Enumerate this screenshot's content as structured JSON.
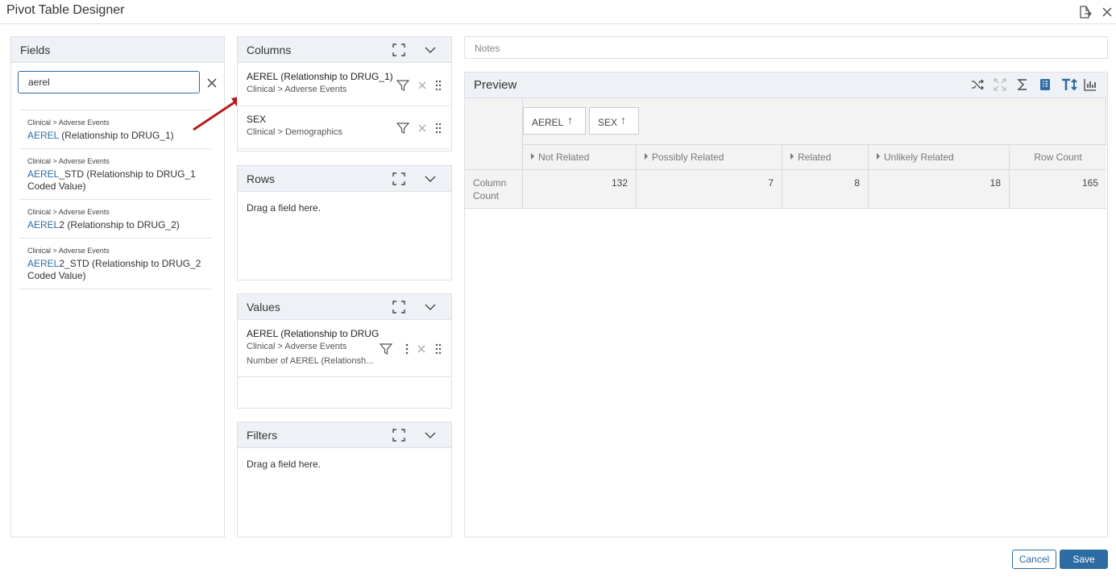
{
  "window": {
    "title": "Pivot Table Designer"
  },
  "fields": {
    "title": "Fields",
    "search_value": "aerel",
    "items": [
      {
        "path": "Clinical > Adverse Events",
        "highlight": "AEREL",
        "rest": " (Relationship to DRUG_1)"
      },
      {
        "path": "Clinical > Adverse Events",
        "highlight": "AEREL",
        "rest": "_STD (Relationship to DRUG_1 Coded Value)"
      },
      {
        "path": "Clinical > Adverse Events",
        "highlight": "AEREL",
        "rest": "2 (Relationship to DRUG_2)"
      },
      {
        "path": "Clinical > Adverse Events",
        "highlight": "AEREL",
        "rest": "2_STD (Relationship to DRUG_2 Coded Value)"
      }
    ]
  },
  "columns": {
    "title": "Columns",
    "items": [
      {
        "name": "AEREL (Relationship to DRUG_1)",
        "path": "Clinical > Adverse Events"
      },
      {
        "name": "SEX",
        "path": "Clinical > Demographics"
      }
    ]
  },
  "rows": {
    "title": "Rows",
    "hint": "Drag a field here."
  },
  "values": {
    "title": "Values",
    "item": {
      "name": "AEREL (Relationship to DRUG",
      "path": "Clinical > Adverse Events",
      "agg": "Number of AEREL (Relationsh..."
    }
  },
  "filters": {
    "title": "Filters",
    "hint": "Drag a field here."
  },
  "notes": {
    "placeholder": "Notes"
  },
  "preview": {
    "title": "Preview",
    "column_chips": [
      "AEREL",
      "SEX"
    ],
    "column_headers": [
      "Not Related",
      "Possibly Related",
      "Related",
      "Unlikely Related"
    ],
    "row_count_label": "Row Count",
    "row_label": "Column Count",
    "values": [
      "132",
      "7",
      "8",
      "18",
      "165"
    ]
  },
  "buttons": {
    "cancel": "Cancel",
    "save": "Save"
  },
  "colors": {
    "accent": "#2d6ca2",
    "arrow": "#b71c1c"
  }
}
